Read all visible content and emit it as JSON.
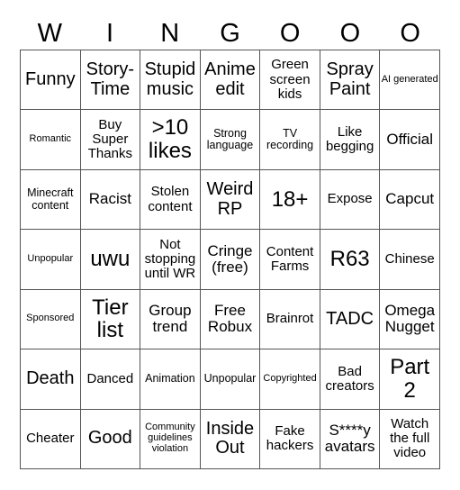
{
  "title_letters": [
    "W",
    "I",
    "N",
    "G",
    "O",
    "O",
    "O"
  ],
  "grid": [
    [
      {
        "text": "Funny",
        "size": "xl"
      },
      {
        "text": "Story-Time",
        "size": "xl"
      },
      {
        "text": "Stupid music",
        "size": "xl"
      },
      {
        "text": "Anime edit",
        "size": "xl"
      },
      {
        "text": "Green screen kids",
        "size": "md"
      },
      {
        "text": "Spray Paint",
        "size": "xl"
      },
      {
        "text": "AI generated",
        "size": "xs"
      }
    ],
    [
      {
        "text": "Romantic",
        "size": "xs"
      },
      {
        "text": "Buy Super Thanks",
        "size": "md"
      },
      {
        "text": ">10 likes",
        "size": "xxl"
      },
      {
        "text": "Strong language",
        "size": "sm"
      },
      {
        "text": "TV recording",
        "size": "sm"
      },
      {
        "text": "Like begging",
        "size": "md"
      },
      {
        "text": "Official",
        "size": "lg"
      }
    ],
    [
      {
        "text": "Minecraft content",
        "size": "sm"
      },
      {
        "text": "Racist",
        "size": "lg"
      },
      {
        "text": "Stolen content",
        "size": "md"
      },
      {
        "text": "Weird RP",
        "size": "xl"
      },
      {
        "text": "18+",
        "size": "xxl"
      },
      {
        "text": "Expose",
        "size": "md"
      },
      {
        "text": "Capcut",
        "size": "lg"
      }
    ],
    [
      {
        "text": "Unpopular",
        "size": "xs"
      },
      {
        "text": "uwu",
        "size": "xxl"
      },
      {
        "text": "Not stopping until WR",
        "size": "md"
      },
      {
        "text": "Cringe (free)",
        "size": "lg"
      },
      {
        "text": "Content Farms",
        "size": "md"
      },
      {
        "text": "R63",
        "size": "xxl"
      },
      {
        "text": "Chinese",
        "size": "md"
      }
    ],
    [
      {
        "text": "Sponsored",
        "size": "xs"
      },
      {
        "text": "Tier list",
        "size": "xxl"
      },
      {
        "text": "Group trend",
        "size": "lg"
      },
      {
        "text": "Free Robux",
        "size": "lg"
      },
      {
        "text": "Brainrot",
        "size": "md"
      },
      {
        "text": "TADC",
        "size": "xl"
      },
      {
        "text": "Omega Nugget",
        "size": "lg"
      }
    ],
    [
      {
        "text": "Death",
        "size": "xl"
      },
      {
        "text": "Danced",
        "size": "md"
      },
      {
        "text": "Animation",
        "size": "sm"
      },
      {
        "text": "Unpopular",
        "size": "sm"
      },
      {
        "text": "Copyrighted",
        "size": "xs"
      },
      {
        "text": "Bad creators",
        "size": "md"
      },
      {
        "text": "Part 2",
        "size": "xxl"
      }
    ],
    [
      {
        "text": "Cheater",
        "size": "md"
      },
      {
        "text": "Good",
        "size": "xl"
      },
      {
        "text": "Community guidelines violation",
        "size": "xs"
      },
      {
        "text": "Inside Out",
        "size": "xl"
      },
      {
        "text": "Fake hackers",
        "size": "md"
      },
      {
        "text": "S****y avatars",
        "size": "lg"
      },
      {
        "text": "Watch the full video",
        "size": "md"
      }
    ]
  ]
}
